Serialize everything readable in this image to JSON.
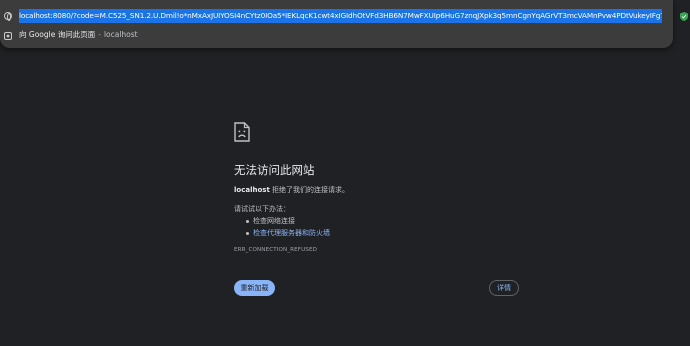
{
  "omnibox": {
    "url": "localhost:8080/?code=M.C525_SN1.2.U.Dmil!o*nMxAxJUIYOSI4nCYtz0IOa5*IEKLqcK1cwt4xIGIdhOtVFd3HB6N7MwFXUIp6HuG7znqJXpk3q5mnCgnYqAGrVT3mcVAMnPvw4PDtVukeyIFg7DQUwmueNNSr2c",
    "suggestion_text": "向 Google 询问此页面",
    "suggestion_separator": "-",
    "suggestion_host": "localhost"
  },
  "error": {
    "title": "无法访问此网站",
    "host": "localhost",
    "description": "拒绝了我们的连接请求。",
    "suggest_heading": "请试试以下办法：",
    "suggestions": [
      {
        "label": "检查网络连接",
        "link": false
      },
      {
        "label": "检查代理服务器和防火墙",
        "link": true
      }
    ],
    "code": "ERR_CONNECTION_REFUSED",
    "reload_label": "重新加载",
    "details_label": "详情"
  },
  "icons": {
    "url_row_icon": "globe-icon",
    "suggestion_row_icon": "google-lens-icon",
    "extension_icon": "shield-icon",
    "error_icon": "sad-page-icon"
  },
  "colors": {
    "background": "#202124",
    "omnibox_bg": "#3c3c3c",
    "selection": "#1a73e8",
    "accent": "#8ab4f8",
    "shield": "#34a853"
  }
}
